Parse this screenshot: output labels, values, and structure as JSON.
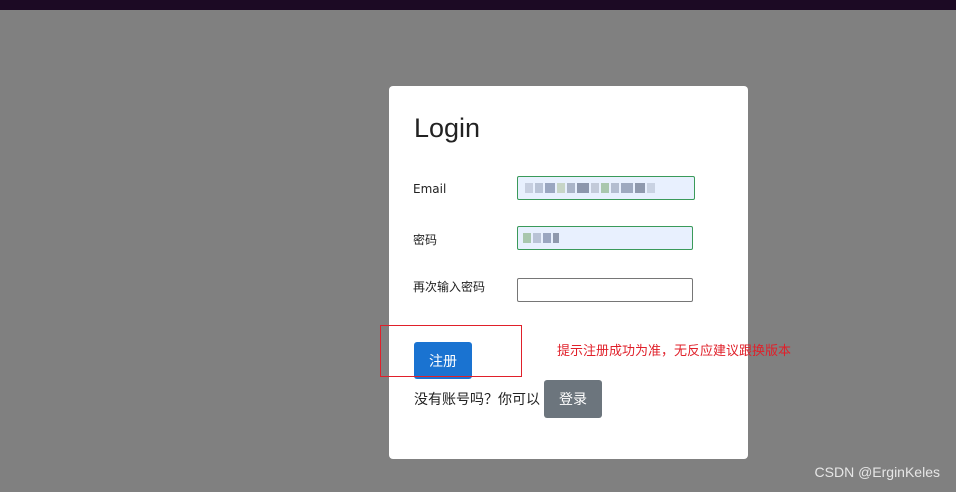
{
  "login_card": {
    "title": "Login",
    "email_label": "Email",
    "password_label": "密码",
    "confirm_password_label": "再次输入密码",
    "register_button": "注册",
    "no_account_text": "没有账号吗？你可以",
    "login_button": "登录"
  },
  "annotation": {
    "text": "提示注册成功为准，无反应建议跟换版本",
    "color": "#e0202a"
  },
  "watermark": "CSDN @ErginKeles",
  "colors": {
    "backdrop": "#808080",
    "topbar": "#1c0a24",
    "primary": "#1a73d1",
    "secondary": "#6c757d",
    "autofill": "#e8f0fe"
  }
}
